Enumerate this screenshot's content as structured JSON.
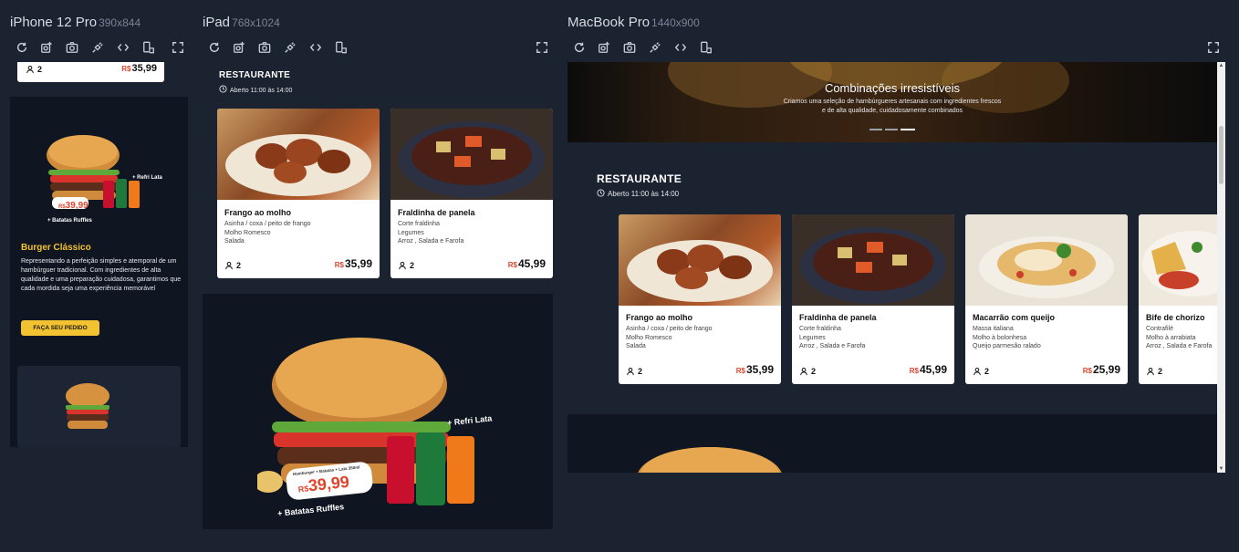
{
  "devices": [
    {
      "name": "iPhone 12 Pro",
      "dims": "390x844"
    },
    {
      "name": "iPad",
      "dims": "768x1024"
    },
    {
      "name": "MacBook Pro",
      "dims": "1440x900"
    }
  ],
  "toolbar_icons": [
    "refresh-icon",
    "screenshot-edit-icon",
    "camera-icon",
    "plug-icon",
    "code-icon",
    "rotate-device-icon",
    "fullscreen-icon"
  ],
  "colors": {
    "bg": "#1b2230",
    "frame_bg": "#111827",
    "accent_yellow": "#f2c230",
    "price_currency": "#e0452b"
  },
  "restaurant": {
    "section_title": "RESTAURANTE",
    "hours": "Aberto 11:00 às 14:00",
    "dishes": [
      {
        "name": "Frango ao molho",
        "lines": [
          "Asinha / coxa / peito de frango",
          "Molho Romesco",
          "Salada"
        ],
        "serves": "2",
        "currency": "R$",
        "price": "35,99"
      },
      {
        "name": "Fraldinha de panela",
        "lines": [
          "Corte fraldinha",
          "Legumes",
          "Arroz , Salada e Farofa"
        ],
        "serves": "2",
        "currency": "R$",
        "price": "45,99"
      },
      {
        "name": "Macarrão com queijo",
        "lines": [
          "Massa italiana",
          "Molho à bolonhesa",
          "Queijo parmesão ralado"
        ],
        "serves": "2",
        "currency": "R$",
        "price": "25,99"
      },
      {
        "name": "Bife de chorizo",
        "lines": [
          "Contrafilé",
          "Molho à arrabiata",
          "Arroz , Salada e Farofa"
        ],
        "serves": "2",
        "currency": "",
        "price": ""
      }
    ]
  },
  "iphone": {
    "top_card": {
      "serves": "2",
      "currency": "R$",
      "price": "35,99"
    },
    "promo": {
      "title": "Burger Clássico",
      "text": "Representando a perfeição simples e atemporal de um hambúrguer tradicional. Com ingredientes de alta qualidade e uma preparação cuidadosa, garantimos que cada mordida seja uma experiência memorável",
      "cta": "FAÇA SEU PEDIDO",
      "badge_currency": "R$",
      "badge_price": "39,99",
      "extra_drink": "+ Refri Lata",
      "extra_fries": "+ Batatas Ruffles"
    }
  },
  "ipad": {
    "promo": {
      "badge_caption": "Hamburger + Batatas + Lata 350ml",
      "badge_currency": "R$",
      "badge_price": "39,99",
      "extra_drink": "+ Refri Lata",
      "extra_fries": "+ Batatas Ruffles"
    }
  },
  "macbook": {
    "carousel": {
      "title": "Combinações irresistíveis",
      "subtitle_line1": "Criamos uma seleção de hambúrgueres artesanais com ingredientes frescos",
      "subtitle_line2": "e de alta qualidade, cuidadosamente combinados",
      "slides": 3,
      "active_slide": 3
    }
  }
}
